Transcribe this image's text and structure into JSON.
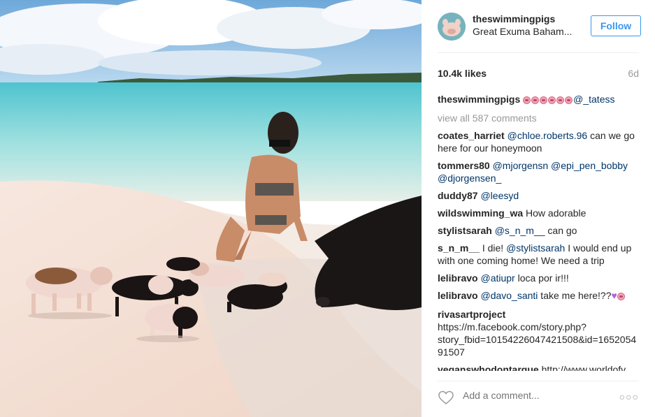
{
  "post": {
    "username": "theswimmingpigs",
    "location": "Great Exuma Baham...",
    "follow_label": "Follow",
    "likes": "10.4k likes",
    "time_ago": "6d"
  },
  "caption": {
    "username": "theswimmingpigs",
    "emoji_count": 6,
    "emoji_name": "pig-face",
    "mention": "@_tatess"
  },
  "view_all": "view all 587 comments",
  "comments": [
    {
      "user": "coates_harriet",
      "mention": "@chloe.roberts.96",
      "text": " can we go here for our honeymoon"
    },
    {
      "user": "tommers80",
      "mention": "@mjorgensn @epi_pen_bobby @djorgensen_",
      "text": ""
    },
    {
      "user": "duddy87",
      "mention": "@leesyd",
      "text": ""
    },
    {
      "user": "wildswimming_wa",
      "mention": "",
      "text": "How adorable"
    },
    {
      "user": "stylistsarah",
      "mention": "@s_n_m__",
      "text": " can go"
    },
    {
      "user": "s_n_m__",
      "pre": "I die! ",
      "mention": "@stylistsarah",
      "text": " I would end up with one coming home! We need a trip"
    },
    {
      "user": "lelibravo",
      "mention": "@atiupr",
      "text": " loca por ir!!!"
    },
    {
      "user": "lelibravo",
      "mention": "@davo_santi",
      "text": " take me here!??"
    },
    {
      "user": "rivasartproject",
      "mention": "",
      "text": "https://m.facebook.com/story.php?story_fbid=10154226047421508&id=165205491507"
    },
    {
      "user": "veganswhodontargue",
      "mention": "",
      "text": "http://www.worldofv"
    }
  ],
  "footer": {
    "add_comment_placeholder": "Add a comment...",
    "heart_icon": "heart-outline-icon",
    "more_icon": "more-options-icon"
  },
  "colors": {
    "accent": "#3897f0",
    "mention": "#003569",
    "muted": "#999999"
  }
}
